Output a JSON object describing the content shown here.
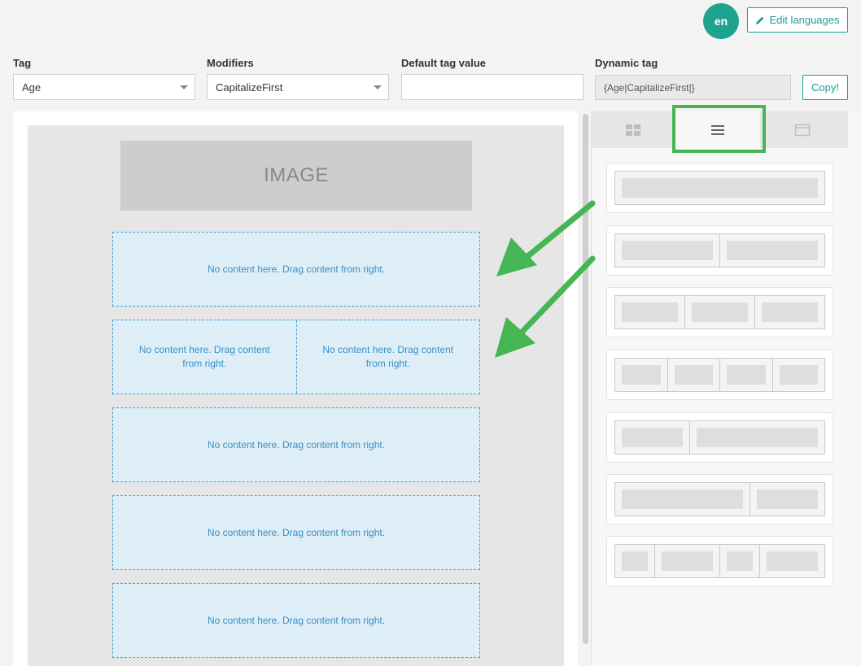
{
  "header": {
    "language_badge": "en",
    "edit_languages_label": "Edit languages",
    "edit_icon": "pencil-icon"
  },
  "form": {
    "tag_label": "Tag",
    "tag_value": "Age",
    "modifiers_label": "Modifiers",
    "modifiers_value": "CapitalizeFirst",
    "default_label": "Default tag value",
    "default_value": "",
    "dynamic_label": "Dynamic tag",
    "dynamic_value": "{Age|CapitalizeFirst|}",
    "copy_label": "Copy!"
  },
  "canvas": {
    "image_placeholder": "IMAGE",
    "drop_text": "No content here. Drag content from right.",
    "rows": [
      {
        "columns": 1
      },
      {
        "columns": 2
      },
      {
        "columns": 1
      },
      {
        "columns": 1
      },
      {
        "columns": 1
      }
    ]
  },
  "panel": {
    "tabs": [
      {
        "icon": "grid-icon",
        "active": false
      },
      {
        "icon": "rows-icon",
        "active": true
      },
      {
        "icon": "window-icon",
        "active": false
      }
    ],
    "layouts": [
      [
        1
      ],
      [
        1,
        1
      ],
      [
        1,
        1,
        1
      ],
      [
        1,
        1,
        1,
        1
      ],
      [
        1,
        2
      ],
      [
        2,
        1
      ],
      [
        1,
        2,
        1,
        2
      ]
    ]
  },
  "colors": {
    "accent": "#1a9e96",
    "badge": "#1fa38e",
    "highlight": "#45b653",
    "drop_text": "#3b8fc4"
  }
}
